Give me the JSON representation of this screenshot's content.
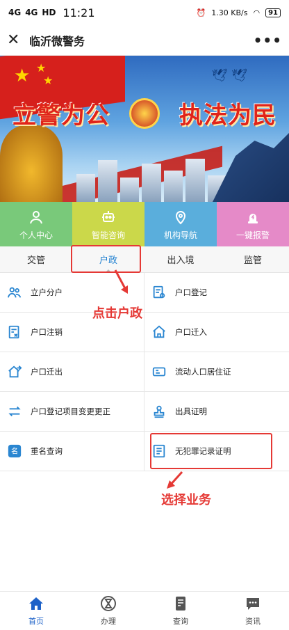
{
  "status_bar": {
    "signal1": "4G",
    "signal2": "4G",
    "hd": "HD",
    "time": "11:21",
    "speed": "1.30",
    "speed_unit": "KB/s",
    "battery": "91"
  },
  "header": {
    "close": "✕",
    "title": "临沂微警务",
    "more": "•••"
  },
  "banner": {
    "slogan_left": "立警为公",
    "slogan_right": "执法为民"
  },
  "tiles": [
    {
      "label": "个人中心",
      "color": "#79c97a",
      "icon": "person-icon"
    },
    {
      "label": "智能咨询",
      "color": "#cbd84a",
      "icon": "robot-icon"
    },
    {
      "label": "机构导航",
      "color": "#5aaedc",
      "icon": "location-pin-icon"
    },
    {
      "label": "一键报警",
      "color": "#e58ac8",
      "icon": "alarm-icon"
    }
  ],
  "tabs": [
    "交管",
    "户政",
    "出入境",
    "监管"
  ],
  "active_tab": "户政",
  "services": [
    {
      "label": "立户分户",
      "icon": "users-icon"
    },
    {
      "label": "户口登记",
      "icon": "register-doc-icon"
    },
    {
      "label": "户口注销",
      "icon": "cancel-doc-icon"
    },
    {
      "label": "户口迁入",
      "icon": "home-in-icon"
    },
    {
      "label": "户口迁出",
      "icon": "home-out-icon"
    },
    {
      "label": "流动人口居住证",
      "icon": "id-card-icon"
    },
    {
      "label": "户口登记项目变更更正",
      "icon": "swap-icon"
    },
    {
      "label": "出具证明",
      "icon": "stamp-icon"
    },
    {
      "label": "重名查询",
      "icon": "name-search-icon"
    },
    {
      "label": "无犯罪记录证明",
      "icon": "certificate-icon"
    }
  ],
  "annotations": {
    "tap_tab": "点击户政",
    "choose_service": "选择业务"
  },
  "bottom_nav": [
    {
      "label": "首页",
      "icon": "home-icon"
    },
    {
      "label": "办理",
      "icon": "hourglass-icon"
    },
    {
      "label": "查询",
      "icon": "query-doc-icon"
    },
    {
      "label": "资讯",
      "icon": "chat-icon"
    }
  ],
  "colors": {
    "accent": "#1e7fd0",
    "annotation": "#e53935",
    "icon_blue": "#2a86d1"
  }
}
